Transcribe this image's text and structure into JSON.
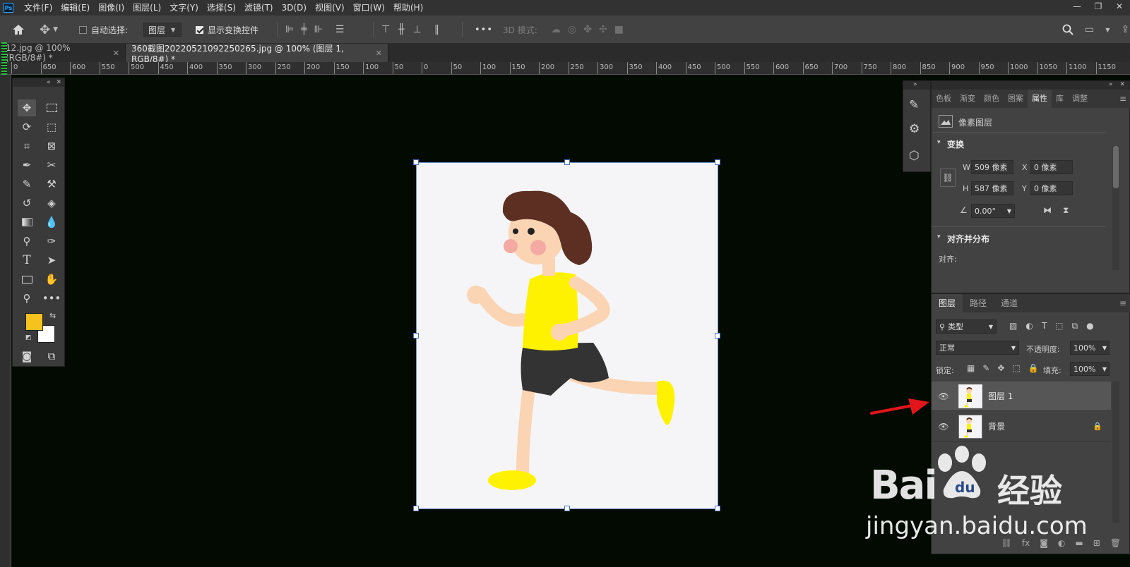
{
  "app": {
    "logo": "Ps",
    "menus": [
      "文件(F)",
      "编辑(E)",
      "图像(I)",
      "图层(L)",
      "文字(Y)",
      "选择(S)",
      "滤镜(T)",
      "3D(D)",
      "视图(V)",
      "窗口(W)",
      "帮助(H)"
    ],
    "window_buttons": [
      "—",
      "❐",
      "✕"
    ]
  },
  "options": {
    "auto_select_label": "自动选择:",
    "auto_select_value": "图层",
    "show_transform_label": "显示变换控件",
    "more": "•••",
    "mode_3d": "3D 模式:"
  },
  "tabs": [
    {
      "label": "12.jpg @ 100%(RGB/8#) *",
      "close": "✕"
    },
    {
      "label": "360截图20220521092250265.jpg @ 100% (图层 1, RGB/8#) *",
      "close": "✕"
    }
  ],
  "ruler_h": [
    "0",
    "650",
    "600",
    "550",
    "500",
    "450",
    "400",
    "350",
    "300",
    "250",
    "200",
    "150",
    "100",
    "50",
    "0",
    "50",
    "100",
    "150",
    "200",
    "250",
    "300",
    "350",
    "400",
    "450",
    "500",
    "550",
    "600",
    "650",
    "700",
    "750",
    "800",
    "850",
    "900",
    "950",
    "1000",
    "1050",
    "1100",
    "1150"
  ],
  "toolbar": {
    "collapse": "«",
    "close": "✕"
  },
  "properties": {
    "tabs": [
      "色板",
      "渐变",
      "颜色",
      "图案",
      "属性",
      "库",
      "调整"
    ],
    "active_tab": "属性",
    "layer_type": "像素图层",
    "transform_title": "变换",
    "w_label": "W",
    "w_value": "509 像素",
    "h_label": "H",
    "h_value": "587 像素",
    "x_label": "X",
    "x_value": "0 像素",
    "y_label": "Y",
    "y_value": "0 像素",
    "angle_value": "0.00°",
    "align_title": "对齐并分布",
    "align_label": "对齐:"
  },
  "layers": {
    "tabs": [
      "图层",
      "路径",
      "通道"
    ],
    "filter_kind": "类型",
    "blend_mode": "正常",
    "opacity_label": "不透明度:",
    "opacity_value": "100%",
    "lock_label": "锁定:",
    "fill_label": "填充:",
    "fill_value": "100%",
    "items": [
      {
        "name": "图层 1",
        "selected": true,
        "locked": false
      },
      {
        "name": "背景",
        "selected": false,
        "locked": true
      }
    ]
  },
  "watermark": {
    "brand": "Bai",
    "brand2": "经验",
    "url": "jingyan.baidu.com"
  },
  "colors": {
    "foreground": "#f6c21e",
    "background": "#ffffff",
    "annotation_arrow": "#e3151a",
    "canvas_bg": "#020a02"
  }
}
